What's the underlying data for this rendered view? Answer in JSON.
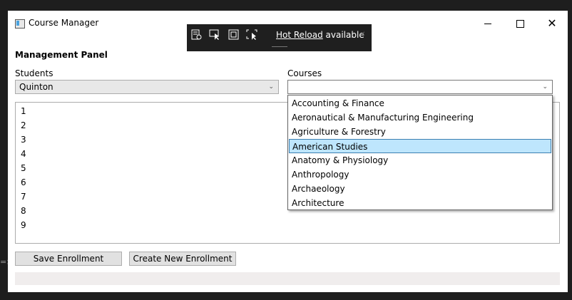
{
  "window": {
    "title": "Course Manager"
  },
  "window_controls": {
    "minimize": "minimize",
    "maximize": "maximize",
    "close": "✕"
  },
  "devbar": {
    "hot_reload_link": "Hot Reload",
    "hot_reload_rest": " available"
  },
  "panel": {
    "heading": "Management Panel"
  },
  "students": {
    "label": "Students",
    "selected": "Quinton"
  },
  "courses": {
    "label": "Courses",
    "selected": "",
    "options": [
      "Accounting & Finance",
      "Aeronautical & Manufacturing Engineering",
      "Agriculture & Forestry",
      "American Studies",
      "Anatomy & Physiology",
      "Anthropology",
      "Archaeology",
      "Architecture"
    ],
    "highlighted": "American Studies"
  },
  "enrollment_list": [
    "1",
    "2",
    "3",
    "4",
    "5",
    "6",
    "7",
    "8",
    "9"
  ],
  "buttons": {
    "save": "Save Enrollment",
    "create": "Create New Enrollment"
  },
  "status": {
    "progress": 0
  }
}
